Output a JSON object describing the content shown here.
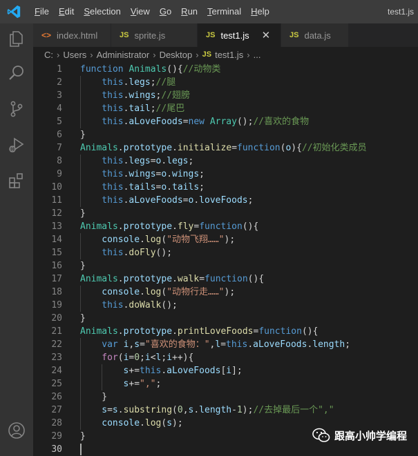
{
  "app": {
    "window_title": "test1.js"
  },
  "menu": [
    "File",
    "Edit",
    "Selection",
    "View",
    "Go",
    "Run",
    "Terminal",
    "Help"
  ],
  "tabs": [
    {
      "icon": "<>",
      "label": "index.html",
      "active": false
    },
    {
      "icon": "JS",
      "label": "sprite.js",
      "active": false
    },
    {
      "icon": "JS",
      "label": "test1.js",
      "active": true,
      "close": "✕"
    },
    {
      "icon": "JS",
      "label": "data.js",
      "active": false
    }
  ],
  "breadcrumb": {
    "parts": [
      "C:",
      "Users",
      "Administrator",
      "Desktop"
    ],
    "file_icon": "JS",
    "file": "test1.js",
    "tail": "..."
  },
  "code_lines": [
    {
      "n": "1",
      "indent": 0,
      "tokens": [
        [
          "k",
          "function"
        ],
        [
          "t",
          " "
        ],
        [
          "f",
          "Animals"
        ],
        [
          "t",
          "(){"
        ],
        [
          "c",
          "//动物类"
        ]
      ]
    },
    {
      "n": "2",
      "indent": 1,
      "tokens": [
        [
          "k",
          "this"
        ],
        [
          "t",
          "."
        ],
        [
          "p",
          "legs"
        ],
        [
          "t",
          ";"
        ],
        [
          "c",
          "//腿"
        ]
      ]
    },
    {
      "n": "3",
      "indent": 1,
      "tokens": [
        [
          "k",
          "this"
        ],
        [
          "t",
          "."
        ],
        [
          "p",
          "wings"
        ],
        [
          "t",
          ";"
        ],
        [
          "c",
          "//翅膀"
        ]
      ]
    },
    {
      "n": "4",
      "indent": 1,
      "tokens": [
        [
          "k",
          "this"
        ],
        [
          "t",
          "."
        ],
        [
          "p",
          "tail"
        ],
        [
          "t",
          ";"
        ],
        [
          "c",
          "//尾巴"
        ]
      ]
    },
    {
      "n": "5",
      "indent": 1,
      "tokens": [
        [
          "k",
          "this"
        ],
        [
          "t",
          "."
        ],
        [
          "p",
          "aLoveFoods"
        ],
        [
          "t",
          "="
        ],
        [
          "k",
          "new"
        ],
        [
          "t",
          " "
        ],
        [
          "f",
          "Array"
        ],
        [
          "t",
          "();"
        ],
        [
          "c",
          "//喜欢的食物"
        ]
      ]
    },
    {
      "n": "6",
      "indent": 0,
      "tokens": [
        [
          "t",
          "}"
        ]
      ]
    },
    {
      "n": "7",
      "indent": 0,
      "tokens": [
        [
          "f",
          "Animals"
        ],
        [
          "t",
          "."
        ],
        [
          "p",
          "prototype"
        ],
        [
          "t",
          "."
        ],
        [
          "m",
          "initialize"
        ],
        [
          "t",
          "="
        ],
        [
          "k",
          "function"
        ],
        [
          "t",
          "("
        ],
        [
          "p",
          "o"
        ],
        [
          "t",
          "){"
        ],
        [
          "c",
          "//初始化类成员"
        ]
      ]
    },
    {
      "n": "8",
      "indent": 1,
      "tokens": [
        [
          "k",
          "this"
        ],
        [
          "t",
          "."
        ],
        [
          "p",
          "legs"
        ],
        [
          "t",
          "="
        ],
        [
          "p",
          "o"
        ],
        [
          "t",
          "."
        ],
        [
          "p",
          "legs"
        ],
        [
          "t",
          ";"
        ]
      ]
    },
    {
      "n": "9",
      "indent": 1,
      "tokens": [
        [
          "k",
          "this"
        ],
        [
          "t",
          "."
        ],
        [
          "p",
          "wings"
        ],
        [
          "t",
          "="
        ],
        [
          "p",
          "o"
        ],
        [
          "t",
          "."
        ],
        [
          "p",
          "wings"
        ],
        [
          "t",
          ";"
        ]
      ]
    },
    {
      "n": "10",
      "indent": 1,
      "tokens": [
        [
          "k",
          "this"
        ],
        [
          "t",
          "."
        ],
        [
          "p",
          "tails"
        ],
        [
          "t",
          "="
        ],
        [
          "p",
          "o"
        ],
        [
          "t",
          "."
        ],
        [
          "p",
          "tails"
        ],
        [
          "t",
          ";"
        ]
      ]
    },
    {
      "n": "11",
      "indent": 1,
      "tokens": [
        [
          "k",
          "this"
        ],
        [
          "t",
          "."
        ],
        [
          "p",
          "aLoveFoods"
        ],
        [
          "t",
          "="
        ],
        [
          "p",
          "o"
        ],
        [
          "t",
          "."
        ],
        [
          "p",
          "loveFoods"
        ],
        [
          "t",
          ";"
        ]
      ]
    },
    {
      "n": "12",
      "indent": 0,
      "tokens": [
        [
          "t",
          "}"
        ]
      ]
    },
    {
      "n": "13",
      "indent": 0,
      "tokens": [
        [
          "f",
          "Animals"
        ],
        [
          "t",
          "."
        ],
        [
          "p",
          "prototype"
        ],
        [
          "t",
          "."
        ],
        [
          "m",
          "fly"
        ],
        [
          "t",
          "="
        ],
        [
          "k",
          "function"
        ],
        [
          "t",
          "(){"
        ]
      ]
    },
    {
      "n": "14",
      "indent": 1,
      "tokens": [
        [
          "p",
          "console"
        ],
        [
          "t",
          "."
        ],
        [
          "m",
          "log"
        ],
        [
          "t",
          "("
        ],
        [
          "s",
          "\"动物飞翔……\""
        ],
        [
          "t",
          ");"
        ]
      ]
    },
    {
      "n": "15",
      "indent": 1,
      "tokens": [
        [
          "k",
          "this"
        ],
        [
          "t",
          "."
        ],
        [
          "m",
          "doFly"
        ],
        [
          "t",
          "();"
        ]
      ]
    },
    {
      "n": "16",
      "indent": 0,
      "tokens": [
        [
          "t",
          "}"
        ]
      ]
    },
    {
      "n": "17",
      "indent": 0,
      "tokens": [
        [
          "f",
          "Animals"
        ],
        [
          "t",
          "."
        ],
        [
          "p",
          "prototype"
        ],
        [
          "t",
          "."
        ],
        [
          "m",
          "walk"
        ],
        [
          "t",
          "="
        ],
        [
          "k",
          "function"
        ],
        [
          "t",
          "(){"
        ]
      ]
    },
    {
      "n": "18",
      "indent": 1,
      "tokens": [
        [
          "p",
          "console"
        ],
        [
          "t",
          "."
        ],
        [
          "m",
          "log"
        ],
        [
          "t",
          "("
        ],
        [
          "s",
          "\"动物行走……\""
        ],
        [
          "t",
          ");"
        ]
      ]
    },
    {
      "n": "19",
      "indent": 1,
      "tokens": [
        [
          "k",
          "this"
        ],
        [
          "t",
          "."
        ],
        [
          "m",
          "doWalk"
        ],
        [
          "t",
          "();"
        ]
      ]
    },
    {
      "n": "20",
      "indent": 0,
      "tokens": [
        [
          "t",
          "}"
        ]
      ]
    },
    {
      "n": "21",
      "indent": 0,
      "tokens": [
        [
          "f",
          "Animals"
        ],
        [
          "t",
          "."
        ],
        [
          "p",
          "prototype"
        ],
        [
          "t",
          "."
        ],
        [
          "m",
          "printLoveFoods"
        ],
        [
          "t",
          "="
        ],
        [
          "k",
          "function"
        ],
        [
          "t",
          "(){"
        ]
      ]
    },
    {
      "n": "22",
      "indent": 1,
      "tokens": [
        [
          "k",
          "var"
        ],
        [
          "t",
          " "
        ],
        [
          "p",
          "i"
        ],
        [
          "t",
          ","
        ],
        [
          "p",
          "s"
        ],
        [
          "t",
          "="
        ],
        [
          "s",
          "\"喜欢的食物：\""
        ],
        [
          "t",
          ","
        ],
        [
          "p",
          "l"
        ],
        [
          "t",
          "="
        ],
        [
          "k",
          "this"
        ],
        [
          "t",
          "."
        ],
        [
          "p",
          "aLoveFoods"
        ],
        [
          "t",
          "."
        ],
        [
          "p",
          "length"
        ],
        [
          "t",
          ";"
        ]
      ]
    },
    {
      "n": "23",
      "indent": 1,
      "tokens": [
        [
          "kc",
          "for"
        ],
        [
          "t",
          "("
        ],
        [
          "p",
          "i"
        ],
        [
          "t",
          "="
        ],
        [
          "n",
          "0"
        ],
        [
          "t",
          ";"
        ],
        [
          "p",
          "i"
        ],
        [
          "t",
          "<"
        ],
        [
          "p",
          "l"
        ],
        [
          "t",
          ";"
        ],
        [
          "p",
          "i"
        ],
        [
          "t",
          "++){"
        ]
      ]
    },
    {
      "n": "24",
      "indent": 2,
      "tokens": [
        [
          "p",
          "s"
        ],
        [
          "t",
          "+="
        ],
        [
          "k",
          "this"
        ],
        [
          "t",
          "."
        ],
        [
          "p",
          "aLoveFoods"
        ],
        [
          "t",
          "["
        ],
        [
          "p",
          "i"
        ],
        [
          "t",
          "];"
        ]
      ]
    },
    {
      "n": "25",
      "indent": 2,
      "tokens": [
        [
          "p",
          "s"
        ],
        [
          "t",
          "+="
        ],
        [
          "s",
          "\",\""
        ],
        [
          "t",
          ";"
        ]
      ]
    },
    {
      "n": "26",
      "indent": 1,
      "tokens": [
        [
          "t",
          "}"
        ]
      ]
    },
    {
      "n": "27",
      "indent": 1,
      "tokens": [
        [
          "p",
          "s"
        ],
        [
          "t",
          "="
        ],
        [
          "p",
          "s"
        ],
        [
          "t",
          "."
        ],
        [
          "m",
          "substring"
        ],
        [
          "t",
          "("
        ],
        [
          "n",
          "0"
        ],
        [
          "t",
          ","
        ],
        [
          "p",
          "s"
        ],
        [
          "t",
          "."
        ],
        [
          "p",
          "length"
        ],
        [
          "t",
          "-"
        ],
        [
          "n",
          "1"
        ],
        [
          "t",
          ");"
        ],
        [
          "c",
          "//去掉最后一个\",\""
        ]
      ]
    },
    {
      "n": "28",
      "indent": 1,
      "tokens": [
        [
          "p",
          "console"
        ],
        [
          "t",
          "."
        ],
        [
          "m",
          "log"
        ],
        [
          "t",
          "("
        ],
        [
          "p",
          "s"
        ],
        [
          "t",
          ");"
        ]
      ]
    },
    {
      "n": "29",
      "indent": 0,
      "tokens": [
        [
          "t",
          "}"
        ]
      ]
    },
    {
      "n": "30",
      "indent": 0,
      "tokens": [],
      "current": true
    }
  ],
  "watermark": {
    "text": "跟高小帅学编程"
  },
  "colors": {
    "keyword": "#569cd6",
    "type": "#4ec9b0",
    "method": "#dcdcaa",
    "property": "#9cdcfe",
    "comment": "#6a9955",
    "string": "#ce9178",
    "number": "#b5cea8",
    "control": "#c586c0",
    "accent": "#007acc"
  }
}
